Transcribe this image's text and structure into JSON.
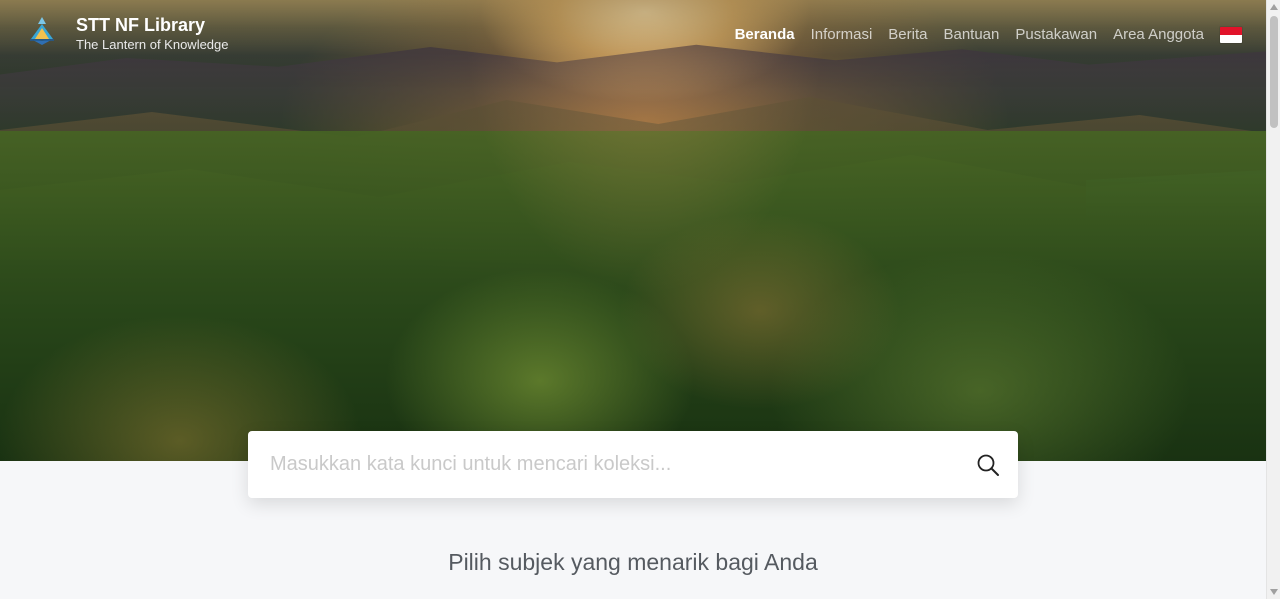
{
  "header": {
    "brand_name": "STT NF Library",
    "brand_tagline": "The Lantern of Knowledge",
    "nav": [
      {
        "label": "Beranda",
        "active": true
      },
      {
        "label": "Informasi",
        "active": false
      },
      {
        "label": "Berita",
        "active": false
      },
      {
        "label": "Bantuan",
        "active": false
      },
      {
        "label": "Pustakawan",
        "active": false
      },
      {
        "label": "Area Anggota",
        "active": false
      }
    ],
    "language_flag": "indonesia-flag-icon"
  },
  "search": {
    "placeholder": "Masukkan kata kunci untuk mencari koleksi...",
    "value": "",
    "icon": "search-icon"
  },
  "main": {
    "subject_heading": "Pilih subjek yang menarik bagi Anda"
  },
  "colors": {
    "heading_text": "#555a60",
    "page_background": "#f6f7f9",
    "flag_red": "#e1132a",
    "flag_white": "#ffffff"
  }
}
